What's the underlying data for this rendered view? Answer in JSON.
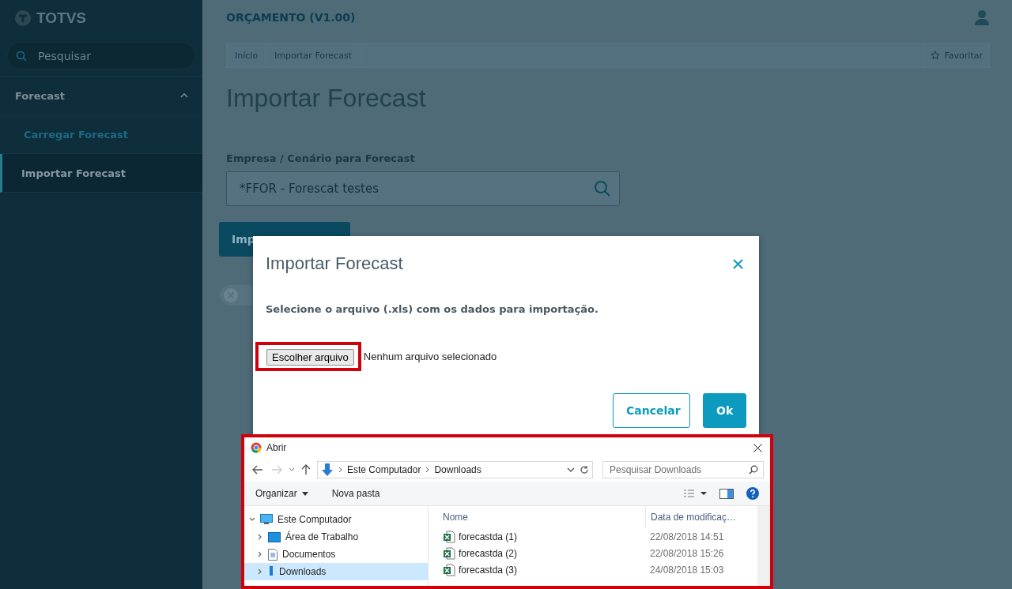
{
  "sidebar": {
    "logo": "TOTVS",
    "search": {
      "placeholder": "Pesquisar"
    },
    "menu": [
      {
        "label": "Forecast",
        "expanded": true,
        "children": [
          {
            "label": "Carregar Forecast",
            "selected": false
          },
          {
            "label": "Importar Forecast",
            "selected": true
          }
        ]
      }
    ]
  },
  "header": {
    "title": "ORÇAMENTO (V1.00)"
  },
  "breadcrumb": {
    "items": [
      "Início",
      "Importar Forecast"
    ],
    "favorite": "Favoritar"
  },
  "page": {
    "title": "Importar Forecast",
    "field": {
      "label": "Empresa / Cenário para Forecast",
      "value": "*FFOR - Forescat testes"
    },
    "button": "Imp"
  },
  "modal": {
    "title": "Importar Forecast",
    "message": "Selecione o arquivo (.xls) com os dados para importação.",
    "file_button": "Escolher arquivo",
    "file_status": "Nenhum arquivo selecionado",
    "buttons": [
      {
        "label": "Cancelar",
        "kind": "secondary"
      },
      {
        "label": "Ok",
        "kind": "primary"
      }
    ]
  },
  "file_dialog": {
    "title": "Abrir",
    "path": [
      "Este Computador",
      "Downloads"
    ],
    "search": {
      "placeholder": "Pesquisar Downloads"
    },
    "toolbar": [
      "Organizar",
      "Nova pasta"
    ],
    "tree": [
      {
        "label": "Este Computador",
        "expanded": true,
        "children": [
          {
            "label": "Área de Trabalho",
            "selected": false
          },
          {
            "label": "Documentos",
            "selected": false
          },
          {
            "label": "Downloads",
            "selected": true
          }
        ]
      }
    ],
    "columns": [
      "Nome",
      "Data de modificaç…"
    ],
    "files": [
      {
        "name": "forecastda (1)",
        "modified": "22/08/2018 14:51"
      },
      {
        "name": "forecastda (2)",
        "modified": "22/08/2018 15:26"
      },
      {
        "name": "forecastda (3)",
        "modified": "24/08/2018 15:03"
      }
    ]
  }
}
